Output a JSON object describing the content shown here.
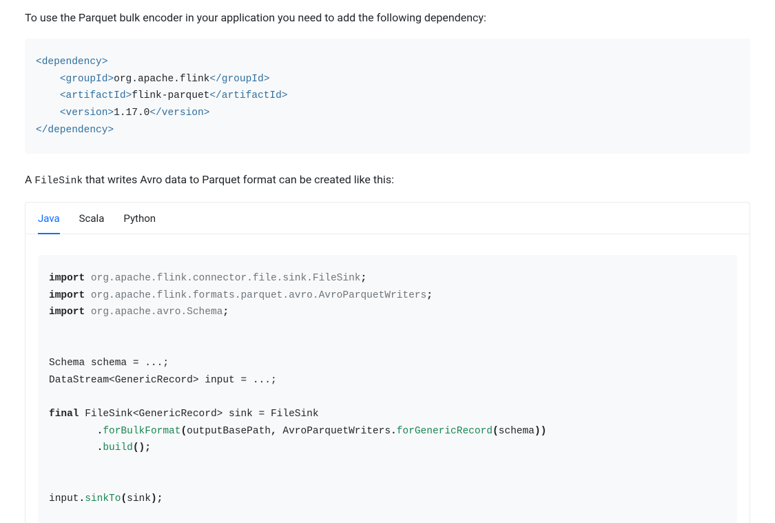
{
  "intro": "To use the Parquet bulk encoder in your application you need to add the following dependency:",
  "dep": {
    "tag_dependency_open": "<dependency>",
    "tag_groupId_open": "<groupId>",
    "groupId": "org.apache.flink",
    "tag_groupId_close": "</groupId>",
    "tag_artifactId_open": "<artifactId>",
    "artifactId": "flink-parquet",
    "tag_artifactId_close": "</artifactId>",
    "tag_version_open": "<version>",
    "version": "1.17.0",
    "tag_version_close": "</version>",
    "tag_dependency_close": "</dependency>"
  },
  "para2_prefix": "A",
  "para2_code": "FileSink",
  "para2_rest": " that writes Avro data to Parquet format can be created like this:",
  "tabs": {
    "java": "Java",
    "scala": "Scala",
    "python": "Python"
  },
  "java": {
    "kw_import": "import",
    "imp1_pkg": "org.apache.flink.connector.file.sink.FileSink",
    "imp2_pkg": "org.apache.flink.formats.parquet.avro.AvroParquetWriters",
    "imp3_pkg": "org.apache.avro.Schema",
    "semicolon": ";",
    "l1": "Schema schema = ...;",
    "l2": "DataStream<GenericRecord> input = ...;",
    "kw_final": "final",
    "l3a": " FileSink<GenericRecord> sink = FileSink",
    "dot": ".",
    "m_forBulk": "forBulkFormat",
    "l4_args_a": "(",
    "l4_args_b": "outputBasePath",
    "comma": ",",
    "sp": " ",
    "l4_args_c": "AvroParquetWriters",
    "m_forGeneric": "forGenericRecord",
    "l4_args_d": "(",
    "l4_args_e": "schema",
    "l4_args_f": "))",
    "m_build": "build",
    "l5_rest": "();",
    "l6_a": "input",
    "m_sinkTo": "sinkTo",
    "l6_b": "(",
    "l6_c": "sink",
    "l6_d": ");"
  }
}
